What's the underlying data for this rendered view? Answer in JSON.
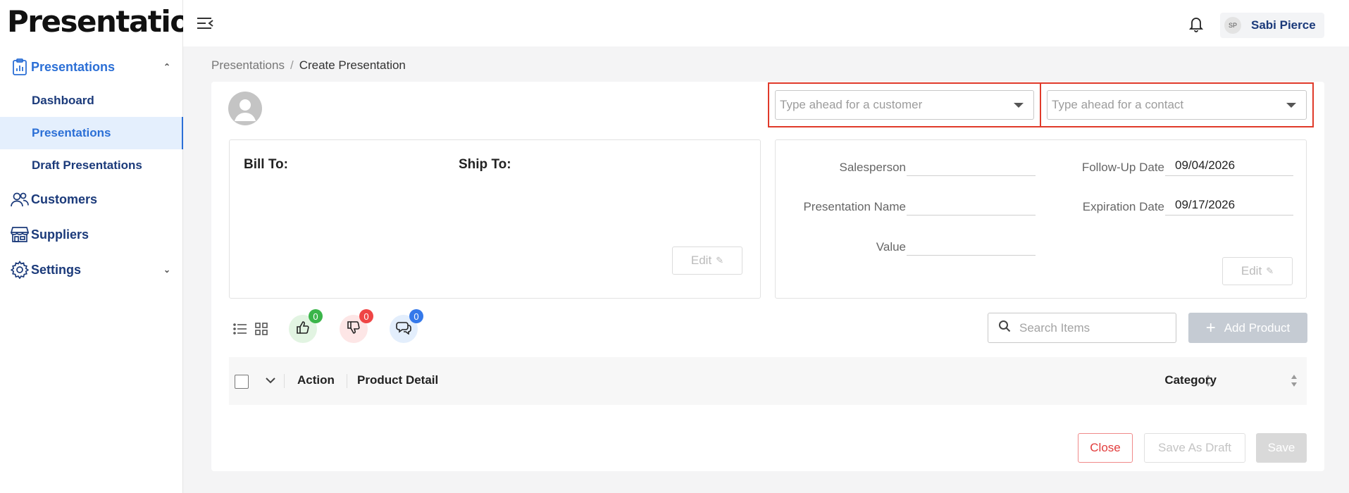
{
  "app": {
    "brand": "Presentations"
  },
  "sidebar": {
    "groups": [
      {
        "label": "Presentations",
        "icon": "clipboard-chart-icon",
        "expanded": true
      },
      {
        "label": "Customers",
        "icon": "users-icon"
      },
      {
        "label": "Suppliers",
        "icon": "store-icon"
      },
      {
        "label": "Settings",
        "icon": "gear-icon",
        "expanded": false
      }
    ],
    "sub_items": [
      {
        "label": "Dashboard"
      },
      {
        "label": "Presentations",
        "active": true
      },
      {
        "label": "Draft Presentations"
      }
    ]
  },
  "header": {
    "user": {
      "initials": "SP",
      "name": "Sabi Pierce"
    }
  },
  "breadcrumb": {
    "root": "Presentations",
    "separator": "/",
    "current": "Create Presentation"
  },
  "form": {
    "customer_placeholder": "Type ahead for a customer",
    "contact_placeholder": "Type ahead for a contact",
    "bill_to_label": "Bill To:",
    "ship_to_label": "Ship To:",
    "edit_label": "Edit",
    "salesperson_label": "Salesperson",
    "salesperson_value": "",
    "presentation_name_label": "Presentation Name",
    "presentation_name_value": "",
    "value_label": "Value",
    "value_value": "",
    "followup_label": "Follow-Up Date",
    "followup_value": "09/04/2026",
    "expiration_label": "Expiration Date",
    "expiration_value": "09/17/2026"
  },
  "toolbar": {
    "likes": "0",
    "dislikes": "0",
    "comments": "0",
    "search_placeholder": "Search Items",
    "add_product_label": "Add Product"
  },
  "table": {
    "columns": [
      "Action",
      "Product Detail",
      "Category"
    ]
  },
  "footer": {
    "close_label": "Close",
    "draft_label": "Save As Draft",
    "save_label": "Save"
  },
  "colors": {
    "accent": "#2b6fd6",
    "nav_text": "#1b3a7a",
    "highlight_border": "#e03a2a",
    "close_red": "#e23c3c"
  }
}
